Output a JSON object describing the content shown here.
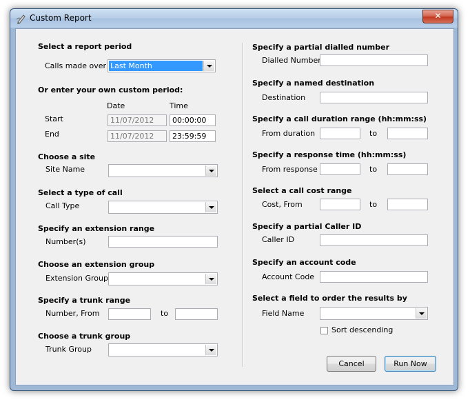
{
  "window": {
    "title": "Custom Report",
    "close_glyph": "✕"
  },
  "left": {
    "report_period": {
      "header": "Select a report period",
      "label": "Calls made over",
      "value": "Last Month"
    },
    "custom_period": {
      "header": "Or enter your own custom period:",
      "date_col": "Date",
      "time_col": "Time",
      "start_label": "Start",
      "end_label": "End",
      "start_date": "11/07/2012",
      "start_time": "00:00:00",
      "end_date": "11/07/2012",
      "end_time": "23:59:59"
    },
    "site": {
      "header": "Choose a site",
      "label": "Site Name"
    },
    "call_type": {
      "header": "Select a type of call",
      "label": "Call Type"
    },
    "extension_range": {
      "header": "Specify an extension range",
      "label": "Number(s)"
    },
    "extension_group": {
      "header": "Choose an extension group",
      "label": "Extension Group"
    },
    "trunk_range": {
      "header": "Specify a trunk range",
      "label": "Number, From",
      "to": "to"
    },
    "trunk_group": {
      "header": "Choose a trunk group",
      "label": "Trunk Group"
    }
  },
  "right": {
    "dialled": {
      "header": "Specify a partial dialled number",
      "label": "Dialled Number"
    },
    "destination": {
      "header": "Specify a named destination",
      "label": "Destination"
    },
    "duration": {
      "header": "Specify a call duration range (hh:mm:ss)",
      "label": "From duration",
      "to": "to"
    },
    "response": {
      "header": "Specify a response time (hh:mm:ss)",
      "label": "From response",
      "to": "to"
    },
    "cost": {
      "header": "Select a call cost range",
      "label": "Cost, From",
      "to": "to"
    },
    "caller_id": {
      "header": "Specify a partial Caller ID",
      "label": "Caller ID"
    },
    "account": {
      "header": "Specify an account code",
      "label": "Account Code"
    },
    "order": {
      "header": "Select a field to order the results by",
      "label": "Field Name",
      "sort_label": "Sort descending"
    }
  },
  "buttons": {
    "cancel": "Cancel",
    "run": "Run Now"
  }
}
